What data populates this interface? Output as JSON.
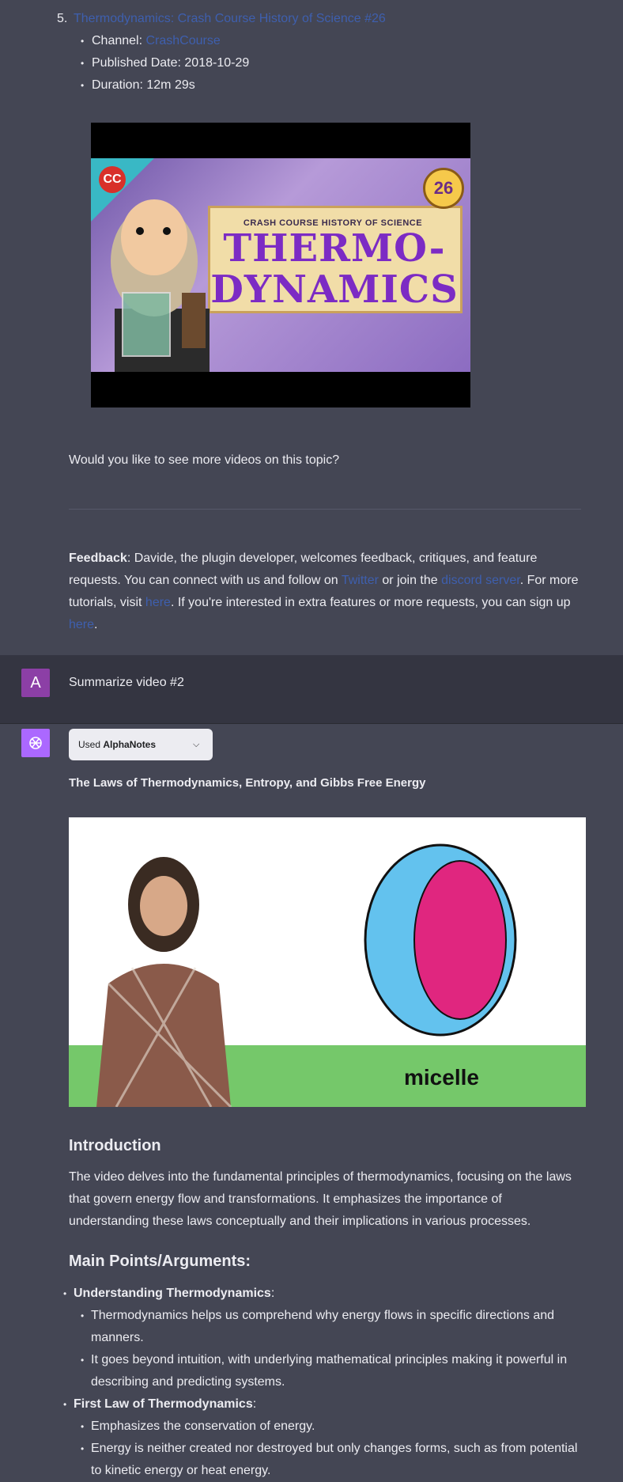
{
  "top": {
    "item_number": "5.",
    "video_title": "Thermodynamics: Crash Course History of Science #26",
    "channel_label": "Channel: ",
    "channel_value": "CrashCourse",
    "published": "Published Date: 2018-10-29",
    "duration": "Duration: 12m 29s",
    "thumb": {
      "cc": "CC",
      "badge": "26",
      "kicker": "CRASH COURSE HISTORY OF SCIENCE",
      "line1": "THERMO-",
      "line2": "DYNAMICS"
    },
    "question": "Would you like to see more videos on this topic?",
    "feedback": {
      "label": "Feedback",
      "t1": ": Davide, the plugin developer, welcomes feedback, critiques, and feature requests. You can connect with us and follow on ",
      "twitter": "Twitter",
      "t2": " or join the ",
      "discord": "discord server",
      "t3": ". For more tutorials, visit ",
      "here1": "here",
      "t4": ". If you're interested in extra features or more requests, you can sign up ",
      "here2": "here",
      "t5": "."
    }
  },
  "user": {
    "avatar": "A",
    "message": "Summarize video #2"
  },
  "assistant": {
    "plugin_used": "Used ",
    "plugin_name": "AlphaNotes",
    "video_title": "The Laws of Thermodynamics, Entropy, and Gibbs Free Energy",
    "thumb_label": "micelle",
    "intro_heading": "Introduction",
    "intro_text": "The video delves into the fundamental principles of thermodynamics, focusing on the laws that govern energy flow and transformations. It emphasizes the importance of understanding these laws conceptually and their implications in various processes.",
    "main_heading": "Main Points/Arguments:",
    "points": [
      {
        "title": "Understanding Thermodynamics",
        "subs": [
          "Thermodynamics helps us comprehend why energy flows in specific directions and manners.",
          "It goes beyond intuition, with underlying mathematical principles making it powerful in describing and predicting systems."
        ]
      },
      {
        "title": "First Law of Thermodynamics",
        "subs": [
          "Emphasizes the conservation of energy.",
          "Energy is neither created nor destroyed but only changes forms, such as from potential to kinetic energy or heat energy."
        ]
      }
    ]
  }
}
